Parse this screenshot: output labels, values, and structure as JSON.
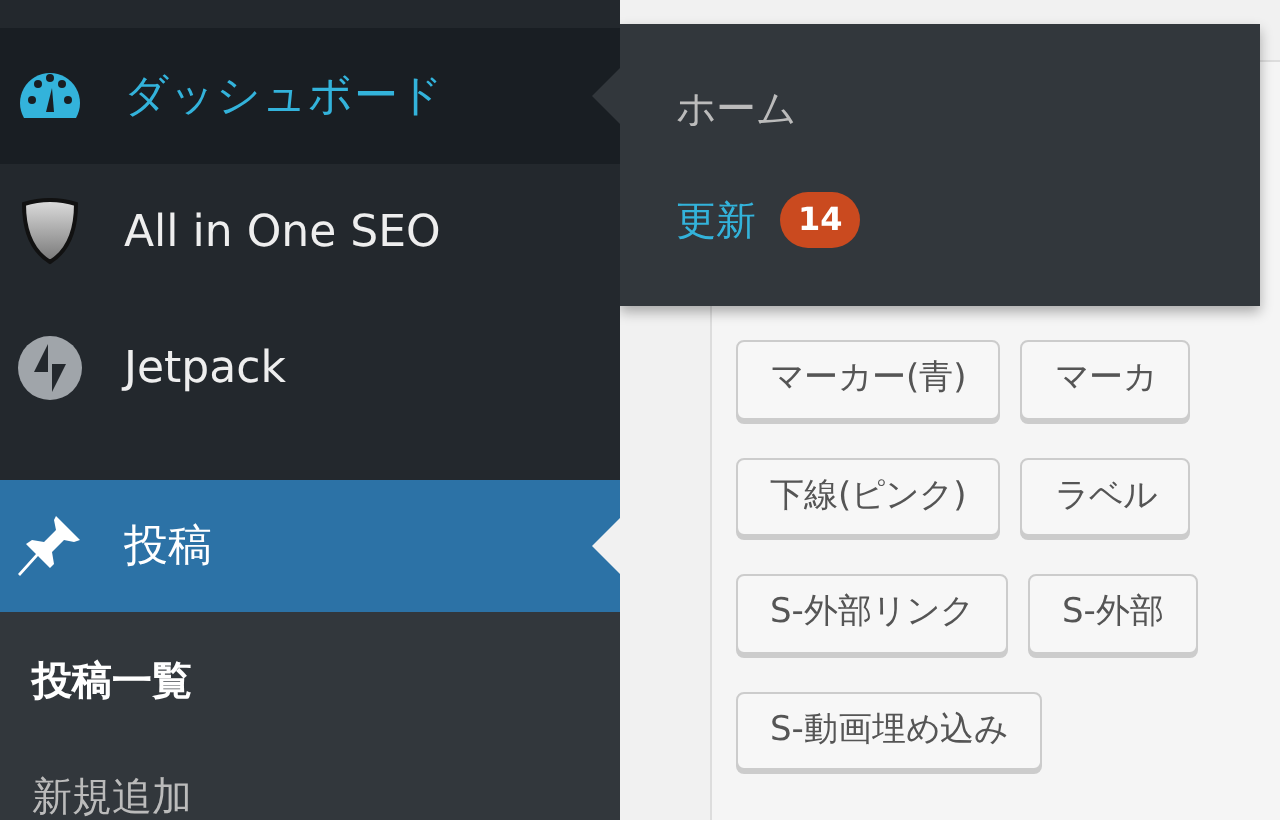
{
  "sidebar": {
    "items": [
      {
        "label": "ダッシュボード",
        "hovered": true,
        "selected": false
      },
      {
        "label": "All in One SEO",
        "hovered": false,
        "selected": false
      },
      {
        "label": "Jetpack",
        "hovered": false,
        "selected": false
      },
      {
        "label": "投稿",
        "hovered": false,
        "selected": true,
        "submenu": [
          {
            "label": "投稿一覧",
            "selected": true
          },
          {
            "label": "新規追加",
            "selected": false
          }
        ]
      }
    ]
  },
  "flyout": {
    "items": [
      {
        "label": "ホーム",
        "selected": false
      },
      {
        "label": "更新",
        "selected": true,
        "badge": "14"
      }
    ]
  },
  "quicktags": {
    "rows": [
      [
        "マーカー(青)",
        "マーカ"
      ],
      [
        "下線(ピンク)",
        "ラベル"
      ],
      [
        "S-外部リンク",
        "S-外部"
      ],
      [
        "S-動画埋め込み"
      ]
    ]
  }
}
